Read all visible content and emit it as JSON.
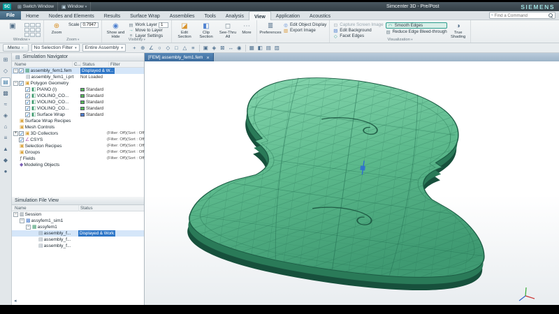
{
  "titlebar": {
    "logo": "SC",
    "switch_window": "Switch Window",
    "window_menu": "Window",
    "title": "Simcenter 3D - Pre/Post",
    "brand": "SIEMENS"
  },
  "tabs": {
    "file": "File",
    "items": [
      "Home",
      "Nodes and Elements",
      "Results",
      "Surface Wrap",
      "Assemblies",
      "Tools",
      "Analysis",
      "View",
      "Application",
      "Acoustics"
    ],
    "active": "View",
    "find_command_placeholder": "Find a Command"
  },
  "ribbon": {
    "window_group": {
      "label": "Window"
    },
    "zoom_group": {
      "label": "Zoom",
      "zoom": "Zoom",
      "scale_label": "Scale",
      "scale_value": "0.7947"
    },
    "visibility_group": {
      "label": "Visibility",
      "show_hide": "Show and Hide",
      "work_layer": "Work Layer",
      "work_layer_value": "1",
      "move_to_layer": "Move to Layer",
      "layer_settings": "Layer Settings"
    },
    "section_group": {
      "edit_section": "Edit Section",
      "clip_section": "Clip Section",
      "see_thru": "See-Thru All",
      "more": "More"
    },
    "display_group": {
      "preferences": "Preferences",
      "edit_object_display": "Edit Object Display",
      "export_image": "Export Image"
    },
    "visualization_group": {
      "label": "Visualization",
      "capture": "Capture Screen Image",
      "edit_background": "Edit Background",
      "facet_edges": "Facet Edges",
      "smooth_edges": "Smooth Edges",
      "reduce_edge": "Reduce Edge Bleed-through",
      "true_shading": "True Shading"
    }
  },
  "menubar": {
    "menu": "Menu",
    "selection_filter": "No Selection Filter",
    "selection_scope": "Entire Assembly",
    "icons": [
      {
        "n": "point-snap-icon",
        "g": "+"
      },
      {
        "n": "fit-view-icon",
        "g": "⊕"
      },
      {
        "n": "angle-snap-icon",
        "g": "∠"
      },
      {
        "n": "circle-center-snap-icon",
        "g": "○"
      },
      {
        "n": "midpoint-snap-icon",
        "g": "◇"
      },
      {
        "n": "endpoint-snap-icon",
        "g": "□"
      },
      {
        "n": "vertex-snap-icon",
        "g": "△"
      },
      {
        "n": "snap-options-icon",
        "g": "≡"
      },
      {
        "n": "sep",
        "g": "|"
      },
      {
        "n": "shaded-view-icon",
        "g": "▣"
      },
      {
        "n": "wireframe-view-icon",
        "g": "◈"
      },
      {
        "n": "orient-view-icon",
        "g": "⊠"
      },
      {
        "n": "pan-view-icon",
        "g": "↔"
      },
      {
        "n": "rotate-view-icon",
        "g": "◉"
      },
      {
        "n": "sep",
        "g": "|"
      },
      {
        "n": "mesh-display-icon",
        "g": "▦"
      },
      {
        "n": "section-view-icon",
        "g": "◧"
      },
      {
        "n": "render-style-icon",
        "g": "▤"
      },
      {
        "n": "background-style-icon",
        "g": "▨"
      }
    ]
  },
  "resource_bar": [
    {
      "n": "assembly-navigator-icon",
      "g": "⊞"
    },
    {
      "n": "constraint-navigator-icon",
      "g": "◇"
    },
    {
      "n": "simulation-navigator-icon",
      "g": "▤",
      "active": true
    },
    {
      "n": "post-processing-navigator-icon",
      "g": "▩"
    },
    {
      "n": "xy-function-navigator-icon",
      "g": "≈"
    },
    {
      "n": "hd3d-tools-icon",
      "g": "◈"
    },
    {
      "n": "web-browser-icon",
      "g": "⌂"
    },
    {
      "n": "history-icon",
      "g": "≡"
    },
    {
      "n": "process-studio-icon",
      "g": "▲"
    },
    {
      "n": "manage-icon",
      "g": "◆"
    },
    {
      "n": "roles-icon",
      "g": "●"
    }
  ],
  "navigator": {
    "title": "Simulation Navigator",
    "columns": [
      "Name",
      "C...",
      "Status",
      "Filter"
    ],
    "rows": [
      {
        "label": "assembly_fem1.fem",
        "indent": 0,
        "exp": "-",
        "check": true,
        "icon": "fem",
        "status": "Displayed & W...",
        "selected": true
      },
      {
        "label": "assembly_fem1_i.prt",
        "indent": 1,
        "icon": "part",
        "status": "Not Loaded"
      },
      {
        "label": "Polygon Geometry",
        "indent": 0,
        "exp": "-",
        "check": true,
        "icon": "folder"
      },
      {
        "label": "PIANO (I)",
        "indent": 1,
        "check": true,
        "icon": "body",
        "swatch": "#58b758",
        "status": "Standard"
      },
      {
        "label": "VIOLINO_CO...",
        "indent": 1,
        "check": true,
        "icon": "body",
        "swatch": "#58b758",
        "status": "Standard"
      },
      {
        "label": "VIOLINO_CO...",
        "indent": 1,
        "check": true,
        "icon": "body",
        "swatch": "#58b758",
        "status": "Standard"
      },
      {
        "label": "VIOLINO_CO...",
        "indent": 1,
        "check": true,
        "icon": "body",
        "swatch": "#58b758",
        "status": "Standard"
      },
      {
        "label": "Surface Wrap",
        "indent": 1,
        "check": true,
        "icon": "body",
        "swatch": "#4f81d0",
        "status": "Standard"
      },
      {
        "label": "Surface Wrap Recipes",
        "indent": 0,
        "icon": "folder"
      },
      {
        "label": "Mesh Controls",
        "indent": 0,
        "icon": "folder"
      },
      {
        "label": "3D Collectors",
        "indent": 0,
        "exp": "+",
        "check": true,
        "icon": "folder",
        "filter": "(Filter: Off)(Sort : Off)"
      },
      {
        "label": "CSYS",
        "indent": 0,
        "check": true,
        "icon": "csys",
        "filter": "(Filter: Off)(Sort : Off)"
      },
      {
        "label": "Selection Recipes",
        "indent": 0,
        "icon": "folder",
        "filter": "(Filter: Off)(Sort : Off)"
      },
      {
        "label": "Groups",
        "indent": 0,
        "icon": "folder",
        "filter": "(Filter: Off)(Sort : Off)"
      },
      {
        "label": "Fields",
        "indent": 0,
        "icon": "fields",
        "filter": "(Filter: Off)(Sort : Off)"
      },
      {
        "label": "Modeling Objects",
        "indent": 0,
        "icon": "objects"
      }
    ]
  },
  "file_view": {
    "title": "Simulation File View",
    "columns": [
      "Name",
      "Status"
    ],
    "rows": [
      {
        "label": "Session",
        "indent": 0,
        "exp": "-",
        "icon": "session"
      },
      {
        "label": "assyfem1_sim1",
        "indent": 1,
        "exp": "-",
        "icon": "sim"
      },
      {
        "label": "assyfem1",
        "indent": 2,
        "exp": "-",
        "icon": "fem"
      },
      {
        "label": "assembly_f...",
        "indent": 3,
        "icon": "part",
        "status": "Displayed & Work",
        "selected": true
      },
      {
        "label": "assembly_f...",
        "indent": 3,
        "icon": "part"
      },
      {
        "label": "assembly_f...",
        "indent": 3,
        "icon": "part"
      }
    ]
  },
  "viewport": {
    "tab": "[FEM] assembly_fem1.fem",
    "close": "×"
  },
  "colors": {
    "accent_teal": "#009e9e",
    "selection_blue": "#2f77c8",
    "mesh_green": "#57b388",
    "mesh_dark_green": "#1e5c46",
    "highlight_teal": "#2e9e8e"
  }
}
